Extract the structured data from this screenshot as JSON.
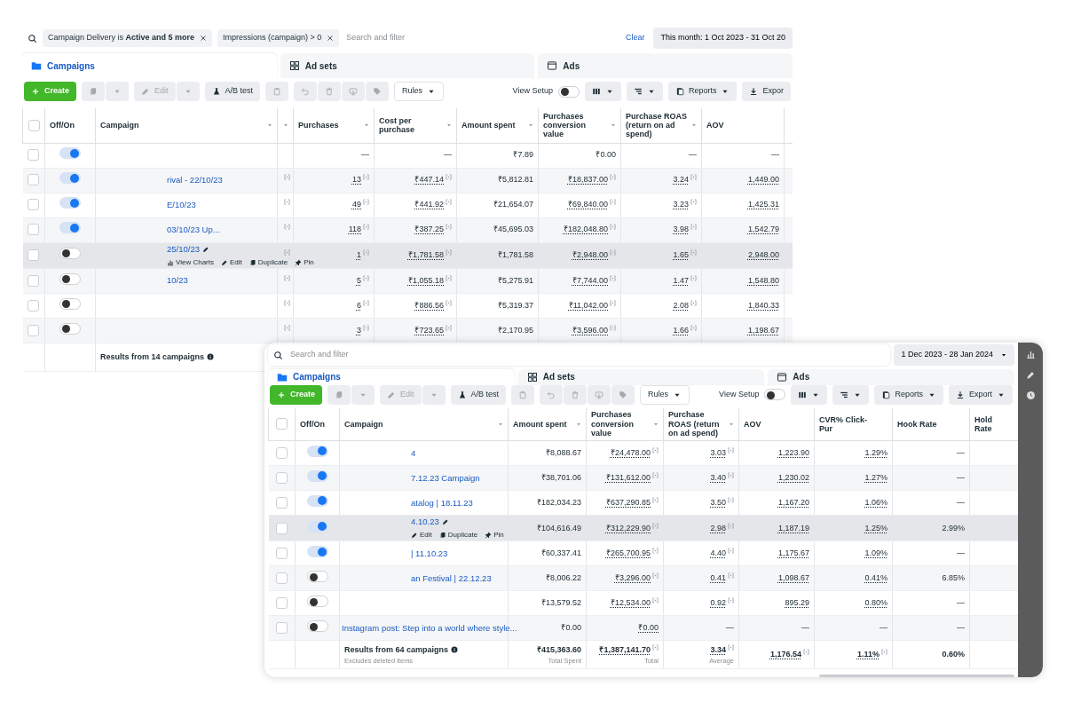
{
  "top_view": {
    "filters": [
      {
        "text": "Campaign Delivery is **Active and 5 more**"
      },
      {
        "text": "Impressions (campaign) > 0"
      }
    ],
    "search_placeholder": "Search and filter",
    "clear": "Clear",
    "date_range": "This month: 1 Oct 2023 - 31 Oct 20",
    "date_menu": false,
    "tabs": [
      {
        "label": "Campaigns",
        "selected": true
      },
      {
        "label": "Ad sets",
        "selected": false
      },
      {
        "label": "Ads",
        "selected": false
      }
    ],
    "toolbar": {
      "create": "Create",
      "edit": "Edit",
      "edit_disabled": true,
      "ab_test": "A/B test",
      "rules": "Rules",
      "view_setup": "View Setup",
      "view_setup_on": false,
      "reports": "Reports",
      "export": "Expor",
      "export_menu": false
    },
    "all_selected": false,
    "fixed_columns": [
      {
        "label": "Off/On",
        "caret": false
      },
      {
        "label": "Campaign",
        "caret": true
      }
    ],
    "columns": [
      {
        "caret": true
      },
      {
        "label": "Purchases",
        "caret": true
      },
      {
        "label": "Cost per purchase",
        "caret": true
      },
      {
        "label": "Amount spent",
        "caret": true
      },
      {
        "label": "Purchases conversion value",
        "caret": true
      },
      {
        "label": "Purchase ROAS (return on ad spend)",
        "caret": true
      },
      {
        "label": "AOV",
        "caret": false
      }
    ],
    "rows": [
      {
        "checked": false,
        "on": true,
        "highlighted": false,
        "cells": [
          {
            "note": false
          },
          {
            "text": "—",
            "note": false,
            "underlined": false
          },
          {
            "text": "—",
            "note": false,
            "underlined": false
          },
          {
            "text": "₹7.89",
            "note": false,
            "underlined": false
          },
          {
            "text": "₹0.00",
            "note": false,
            "underlined": false
          },
          {
            "text": "—",
            "note": false,
            "underlined": false
          },
          {
            "text": "—",
            "note": false,
            "underlined": false
          }
        ]
      },
      {
        "checked": false,
        "on": true,
        "highlighted": false,
        "name": "rival - 22/10/23",
        "cells": [
          {
            "note": true
          },
          {
            "text": "13",
            "note": true,
            "underlined": true
          },
          {
            "text": "₹447.14",
            "note": true,
            "underlined": true
          },
          {
            "text": "₹5,812.81",
            "note": false,
            "underlined": false
          },
          {
            "text": "₹18,837.00",
            "note": true,
            "underlined": true
          },
          {
            "text": "3.24",
            "note": true,
            "underlined": true
          },
          {
            "text": "1,449.00",
            "note": false,
            "underlined": true
          }
        ]
      },
      {
        "checked": false,
        "on": true,
        "highlighted": false,
        "name": "E/10/23",
        "cells": [
          {
            "note": true
          },
          {
            "text": "49",
            "note": true,
            "underlined": true
          },
          {
            "text": "₹441.92",
            "note": true,
            "underlined": true
          },
          {
            "text": "₹21,654.07",
            "note": false,
            "underlined": false
          },
          {
            "text": "₹69,840.00",
            "note": true,
            "underlined": true
          },
          {
            "text": "3.23",
            "note": true,
            "underlined": true
          },
          {
            "text": "1,425.31",
            "note": false,
            "underlined": true
          }
        ]
      },
      {
        "checked": false,
        "on": true,
        "highlighted": false,
        "name": "03/10/23 Up...",
        "cells": [
          {
            "note": true
          },
          {
            "text": "118",
            "note": true,
            "underlined": true
          },
          {
            "text": "₹387.25",
            "note": true,
            "underlined": true
          },
          {
            "text": "₹45,695.03",
            "note": false,
            "underlined": false
          },
          {
            "text": "₹182,048.80",
            "note": true,
            "underlined": true
          },
          {
            "text": "3.98",
            "note": true,
            "underlined": true
          },
          {
            "text": "1,542.79",
            "note": false,
            "underlined": true
          }
        ]
      },
      {
        "checked": false,
        "on": false,
        "highlighted": true,
        "name": "25/10/23",
        "actions": [
          {
            "kind": "charts",
            "label": "View Charts"
          },
          {
            "kind": "edit",
            "label": "Edit"
          },
          {
            "kind": "duplicate",
            "label": "Duplicate"
          },
          {
            "kind": "pin",
            "label": "Pin"
          }
        ],
        "cells": [
          {
            "note": true
          },
          {
            "text": "1",
            "note": true,
            "underlined": true
          },
          {
            "text": "₹1,781.58",
            "note": true,
            "underlined": true
          },
          {
            "text": "₹1,781.58",
            "note": false,
            "underlined": false
          },
          {
            "text": "₹2,948.00",
            "note": true,
            "underlined": true
          },
          {
            "text": "1.65",
            "note": true,
            "underlined": true
          },
          {
            "text": "2,948.00",
            "note": false,
            "underlined": true
          }
        ]
      },
      {
        "checked": false,
        "on": false,
        "highlighted": false,
        "name": "10/23",
        "cells": [
          {
            "note": true
          },
          {
            "text": "5",
            "note": true,
            "underlined": true
          },
          {
            "text": "₹1,055.18",
            "note": true,
            "underlined": true
          },
          {
            "text": "₹5,275.91",
            "note": false,
            "underlined": false
          },
          {
            "text": "₹7,744.00",
            "note": true,
            "underlined": true
          },
          {
            "text": "1.47",
            "note": true,
            "underlined": true
          },
          {
            "text": "1,548.80",
            "note": false,
            "underlined": true
          }
        ]
      },
      {
        "checked": false,
        "on": false,
        "highlighted": false,
        "cells": [
          {
            "note": true
          },
          {
            "text": "6",
            "note": true,
            "underlined": true
          },
          {
            "text": "₹886.56",
            "note": true,
            "underlined": true
          },
          {
            "text": "₹5,319.37",
            "note": false,
            "underlined": false
          },
          {
            "text": "₹11,042.00",
            "note": true,
            "underlined": true
          },
          {
            "text": "2.08",
            "note": true,
            "underlined": true
          },
          {
            "text": "1,840.33",
            "note": false,
            "underlined": true
          }
        ]
      },
      {
        "checked": false,
        "on": false,
        "highlighted": false,
        "cells": [
          {
            "note": true
          },
          {
            "text": "3",
            "note": true,
            "underlined": true
          },
          {
            "text": "₹723.65",
            "note": true,
            "underlined": true
          },
          {
            "text": "₹2,170.95",
            "note": false,
            "underlined": false
          },
          {
            "text": "₹3,596.00",
            "note": true,
            "underlined": true
          },
          {
            "text": "1.66",
            "note": true,
            "underlined": true
          },
          {
            "text": "1,198.67",
            "note": false,
            "underlined": true
          }
        ]
      }
    ],
    "footer": {
      "label": "Results from 14 campaigns"
    }
  },
  "bottom_view": {
    "search_placeholder": "Search and filter",
    "date_range": "1 Dec 2023 - 28 Jan 2024",
    "date_menu": true,
    "tabs": [
      {
        "label": "Campaigns",
        "selected": true
      },
      {
        "label": "Ad sets",
        "selected": false
      },
      {
        "label": "Ads",
        "selected": false
      }
    ],
    "toolbar": {
      "create": "Create",
      "edit": "Edit",
      "edit_disabled": true,
      "ab_test": "A/B test",
      "rules": "Rules",
      "view_setup": "View Setup",
      "view_setup_on": false,
      "reports": "Reports",
      "export": "Export",
      "export_menu": true
    },
    "all_selected": false,
    "fixed_columns": [
      {
        "label": "Off/On",
        "caret": false
      },
      {
        "label": "Campaign",
        "caret": true
      }
    ],
    "columns": [
      {
        "label": "Amount spent",
        "caret": true
      },
      {
        "label": "Purchases conversion value",
        "caret": true
      },
      {
        "label": "Purchase ROAS (return on ad spend)",
        "caret": true
      },
      {
        "label": "AOV",
        "caret": false
      },
      {
        "label": "CVR% Click-Pur",
        "caret": false
      },
      {
        "label": "Hook Rate",
        "caret": false
      },
      {
        "label": "Hold Rate",
        "caret": false
      }
    ],
    "rows": [
      {
        "checked": false,
        "on": true,
        "highlighted": false,
        "name": "4",
        "cells": [
          {
            "text": "₹8,088.67",
            "note": false,
            "underlined": false
          },
          {
            "text": "₹24,478.00",
            "note": true,
            "underlined": true
          },
          {
            "text": "3.03",
            "note": true,
            "underlined": true
          },
          {
            "text": "1,223.90",
            "note": false,
            "underlined": true
          },
          {
            "text": "1.29%",
            "note": false,
            "underlined": true
          },
          {
            "text": "—",
            "note": false,
            "underlined": false
          }
        ]
      },
      {
        "checked": false,
        "on": true,
        "highlighted": false,
        "name": "7.12.23 Campaign",
        "cells": [
          {
            "text": "₹38,701.06",
            "note": false,
            "underlined": false
          },
          {
            "text": "₹131,612.00",
            "note": true,
            "underlined": true
          },
          {
            "text": "3.40",
            "note": true,
            "underlined": true
          },
          {
            "text": "1,230.02",
            "note": false,
            "underlined": true
          },
          {
            "text": "1.27%",
            "note": false,
            "underlined": true
          },
          {
            "text": "—",
            "note": false,
            "underlined": false
          }
        ]
      },
      {
        "checked": false,
        "on": true,
        "highlighted": false,
        "name": "atalog | 18.11.23",
        "cells": [
          {
            "text": "₹182,034.23",
            "note": false,
            "underlined": false
          },
          {
            "text": "₹637,290.85",
            "note": true,
            "underlined": true
          },
          {
            "text": "3.50",
            "note": true,
            "underlined": true
          },
          {
            "text": "1,167.20",
            "note": false,
            "underlined": true
          },
          {
            "text": "1.06%",
            "note": false,
            "underlined": true
          },
          {
            "text": "—",
            "note": false,
            "underlined": false
          }
        ]
      },
      {
        "checked": false,
        "on": true,
        "highlighted": true,
        "name": "4.10.23",
        "actions": [
          {
            "kind": "edit",
            "label": "Edit"
          },
          {
            "kind": "duplicate",
            "label": "Duplicate"
          },
          {
            "kind": "pin",
            "label": "Pin"
          }
        ],
        "cells": [
          {
            "text": "₹104,616.49",
            "note": false,
            "underlined": false
          },
          {
            "text": "₹312,229.90",
            "note": true,
            "underlined": true
          },
          {
            "text": "2.98",
            "note": true,
            "underlined": true
          },
          {
            "text": "1,187.19",
            "note": false,
            "underlined": true
          },
          {
            "text": "1.25%",
            "note": false,
            "underlined": true
          },
          {
            "text": "2.99%",
            "note": false,
            "underlined": false
          }
        ]
      },
      {
        "checked": false,
        "on": true,
        "highlighted": false,
        "name": "| 11.10.23",
        "cells": [
          {
            "text": "₹60,337.41",
            "note": false,
            "underlined": false
          },
          {
            "text": "₹265,700.95",
            "note": true,
            "underlined": true
          },
          {
            "text": "4.40",
            "note": true,
            "underlined": true
          },
          {
            "text": "1,175.67",
            "note": false,
            "underlined": true
          },
          {
            "text": "1.09%",
            "note": false,
            "underlined": true
          },
          {
            "text": "—",
            "note": false,
            "underlined": false
          }
        ]
      },
      {
        "checked": false,
        "on": false,
        "highlighted": false,
        "name": "an Festival | 22.12.23",
        "cells": [
          {
            "text": "₹8,006.22",
            "note": false,
            "underlined": false
          },
          {
            "text": "₹3,296.00",
            "note": true,
            "underlined": true
          },
          {
            "text": "0.41",
            "note": true,
            "underlined": true
          },
          {
            "text": "1,098.67",
            "note": false,
            "underlined": true
          },
          {
            "text": "0.41%",
            "note": false,
            "underlined": true
          },
          {
            "text": "6.85%",
            "note": false,
            "underlined": false
          }
        ]
      },
      {
        "checked": false,
        "on": false,
        "highlighted": false,
        "cells": [
          {
            "text": "₹13,579.52",
            "note": false,
            "underlined": false
          },
          {
            "text": "₹12,534.00",
            "note": true,
            "underlined": true
          },
          {
            "text": "0.92",
            "note": true,
            "underlined": true
          },
          {
            "text": "895.29",
            "note": false,
            "underlined": true
          },
          {
            "text": "0.80%",
            "note": false,
            "underlined": true
          },
          {
            "text": "—",
            "note": false,
            "underlined": false
          }
        ]
      },
      {
        "checked": false,
        "on": false,
        "highlighted": false,
        "name": "Instagram post: Step into a world where style...",
        "cells": [
          {
            "text": "₹0.00",
            "note": false,
            "underlined": false
          },
          {
            "text": "₹0.00",
            "note": false,
            "underlined": true
          },
          {
            "text": "—",
            "note": false,
            "underlined": false
          },
          {
            "text": "—",
            "note": false,
            "underlined": false
          },
          {
            "text": "—",
            "note": false,
            "underlined": false
          },
          {
            "text": "—",
            "note": false,
            "underlined": false
          }
        ]
      }
    ],
    "footer": {
      "label": "Results from 64 campaigns",
      "sub": "Excludes deleted items",
      "cells": [
        {
          "text": "₹415,363.60",
          "sub": "Total Spent",
          "note": false,
          "underlined": false
        },
        {
          "text": "₹1,387,141.70",
          "sub": "Total",
          "note": true,
          "underlined": true
        },
        {
          "text": "3.34",
          "sub": "Average",
          "note": true,
          "underlined": true
        },
        {
          "text": "1,176.54",
          "note": true,
          "underlined": true
        },
        {
          "text": "1.11%",
          "note": true,
          "underlined": true
        },
        {
          "text": "0.60%",
          "note": false,
          "underlined": false
        }
      ]
    }
  }
}
